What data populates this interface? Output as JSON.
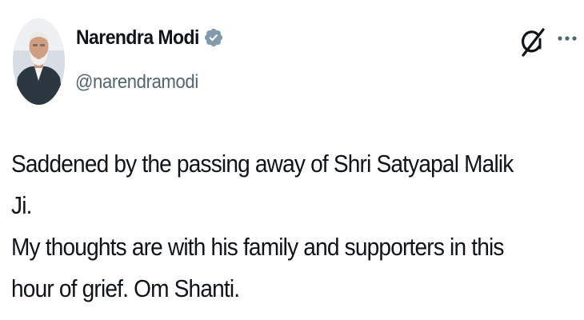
{
  "tweet": {
    "author": {
      "display_name": "Narendra Modi",
      "handle": "@narendramodi",
      "verified": true
    },
    "icons": {
      "avatar": "profile-photo",
      "verified": "verified-badge-icon",
      "grok": "grok-icon",
      "more": "more-options-icon"
    },
    "colors": {
      "text": "#0f1419",
      "handle": "#536471",
      "verified_badge": "#829aab"
    },
    "text": "Saddened by the passing away of Shri Satyapal Malik Ji.\nMy thoughts are with his family and supporters in this\nhour of grief. Om Shanti."
  }
}
